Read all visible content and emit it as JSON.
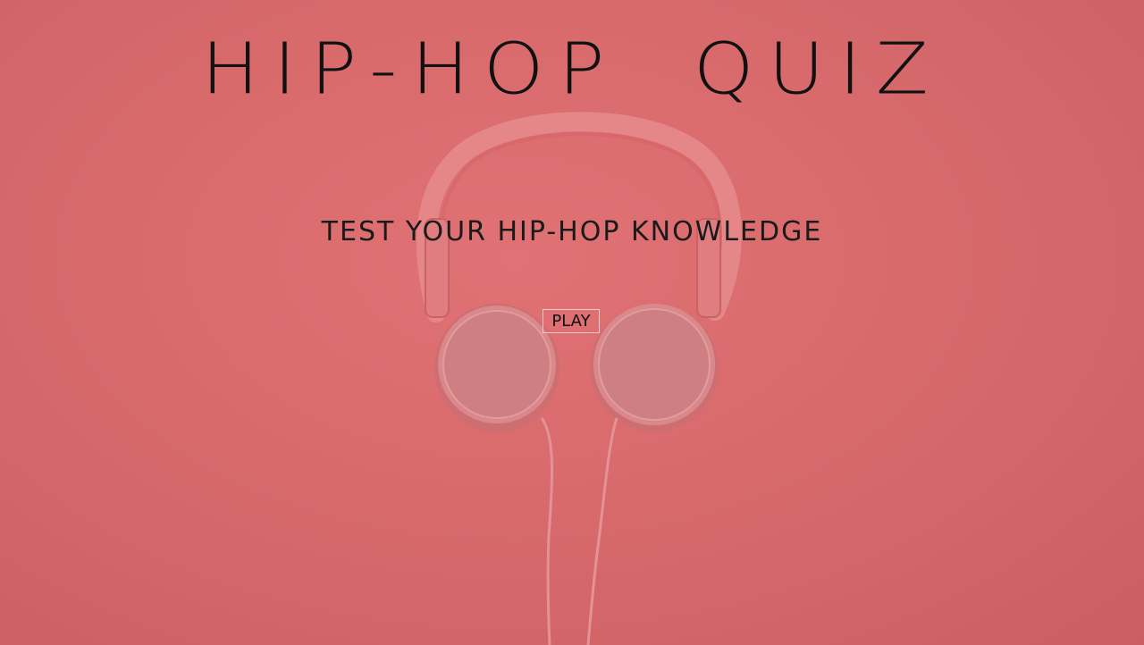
{
  "page": {
    "title": "HIP-HOP QUIZ",
    "subtitle": "TEST YOUR HIP-HOP KNOWLEDGE",
    "play_label": "PLAY"
  },
  "background": {
    "image": "headphones-icon",
    "color": "#d96b6d"
  }
}
